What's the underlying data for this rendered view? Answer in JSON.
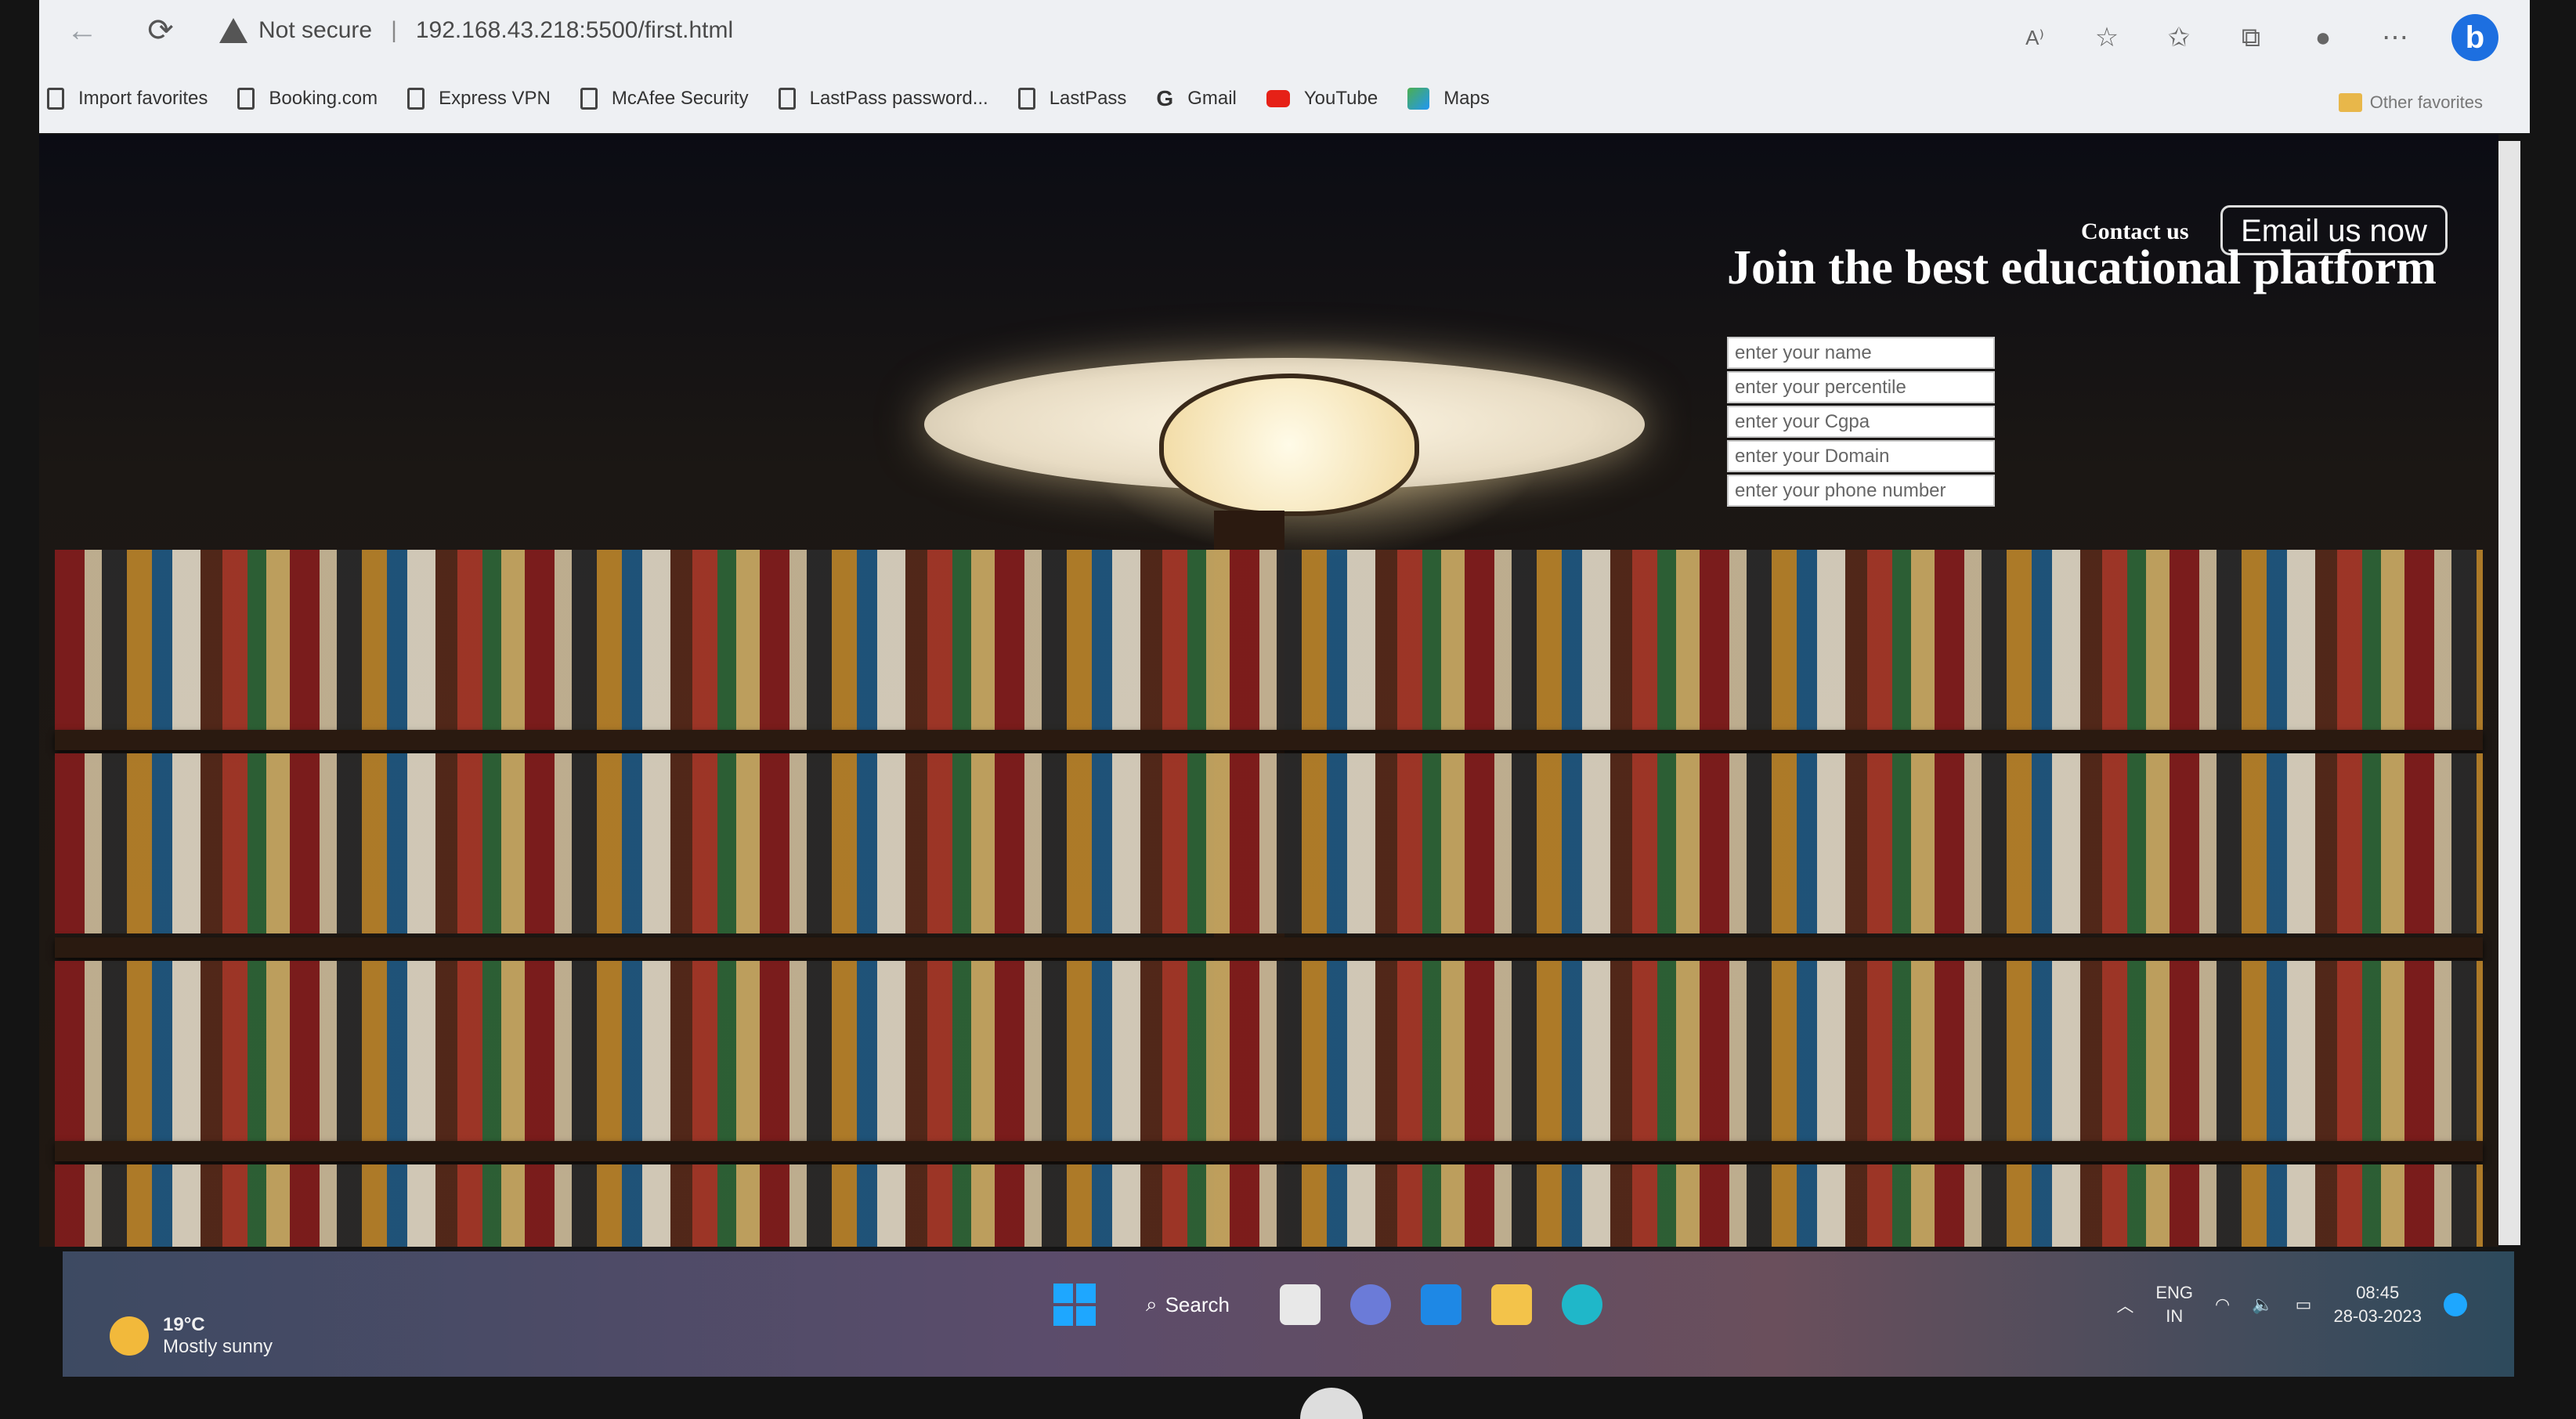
{
  "browser": {
    "security_label": "Not secure",
    "url": "192.168.43.218:5500/first.html",
    "read_aloud_icon": "read-aloud-icon",
    "bookmarks": [
      {
        "label": "Import favorites",
        "icon": "import-icon"
      },
      {
        "label": "Booking.com",
        "icon": "page-icon"
      },
      {
        "label": "Express VPN",
        "icon": "page-icon"
      },
      {
        "label": "McAfee Security",
        "icon": "page-icon"
      },
      {
        "label": "LastPass password...",
        "icon": "page-icon"
      },
      {
        "label": "LastPass",
        "icon": "page-icon"
      },
      {
        "label": "Gmail",
        "icon": "google-icon"
      },
      {
        "label": "YouTube",
        "icon": "youtube-icon"
      },
      {
        "label": "Maps",
        "icon": "maps-icon"
      }
    ],
    "other_favorites": "Other favorites"
  },
  "page": {
    "contact_label": "Contact us",
    "email_button": "Email us now",
    "headline": "Join the best educational platform",
    "form": {
      "name_placeholder": "enter your name",
      "percentile_placeholder": "enter your percentile",
      "cgpa_placeholder": "enter your Cgpa",
      "domain_placeholder": "enter your Domain",
      "phone_placeholder": "enter your phone number"
    }
  },
  "taskbar": {
    "weather_temp": "19°C",
    "weather_desc": "Mostly sunny",
    "search_label": "Search",
    "lang_line1": "ENG",
    "lang_line2": "IN",
    "time": "08:45",
    "date": "28-03-2023"
  },
  "colors": {
    "taskbar_accent": "#1ea7ff",
    "bing": "#1d6fe0",
    "youtube": "#e62117"
  }
}
